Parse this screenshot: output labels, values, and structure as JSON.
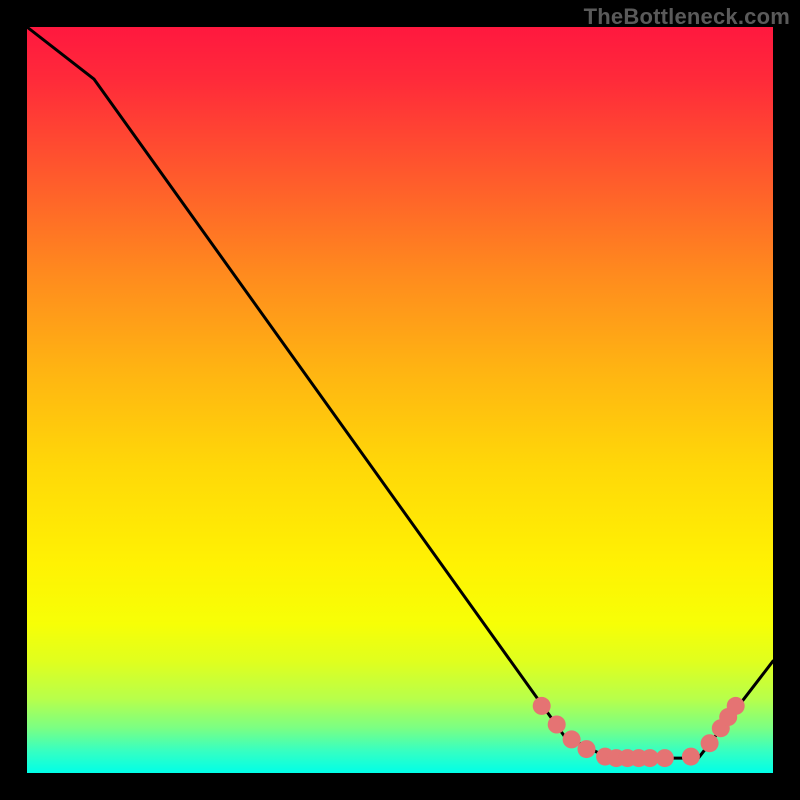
{
  "watermark": "TheBottleneck.com",
  "chart_data": {
    "type": "line",
    "title": "",
    "xlabel": "",
    "ylabel": "",
    "xlim": [
      0,
      100
    ],
    "ylim": [
      0,
      100
    ],
    "grid": false,
    "legend": false,
    "background": "rainbow-vertical-gradient",
    "series": [
      {
        "name": "curve",
        "color": "#000000",
        "x": [
          0,
          9,
          72,
          78,
          90,
          100
        ],
        "y": [
          100,
          93,
          5,
          2,
          2,
          15
        ]
      }
    ],
    "markers": [
      {
        "name": "low-region-dots",
        "shape": "circle",
        "color": "#e57373",
        "radius_pct": 1.2,
        "points": [
          {
            "x": 69,
            "y": 9
          },
          {
            "x": 71,
            "y": 6.5
          },
          {
            "x": 73,
            "y": 4.5
          },
          {
            "x": 75,
            "y": 3.2
          },
          {
            "x": 77.5,
            "y": 2.2
          },
          {
            "x": 79,
            "y": 2.0
          },
          {
            "x": 80.5,
            "y": 2.0
          },
          {
            "x": 82,
            "y": 2.0
          },
          {
            "x": 83.5,
            "y": 2.0
          },
          {
            "x": 85.5,
            "y": 2.0
          },
          {
            "x": 89,
            "y": 2.2
          },
          {
            "x": 91.5,
            "y": 4.0
          },
          {
            "x": 93,
            "y": 6.0
          },
          {
            "x": 94,
            "y": 7.5
          },
          {
            "x": 95,
            "y": 9.0
          }
        ]
      }
    ]
  }
}
